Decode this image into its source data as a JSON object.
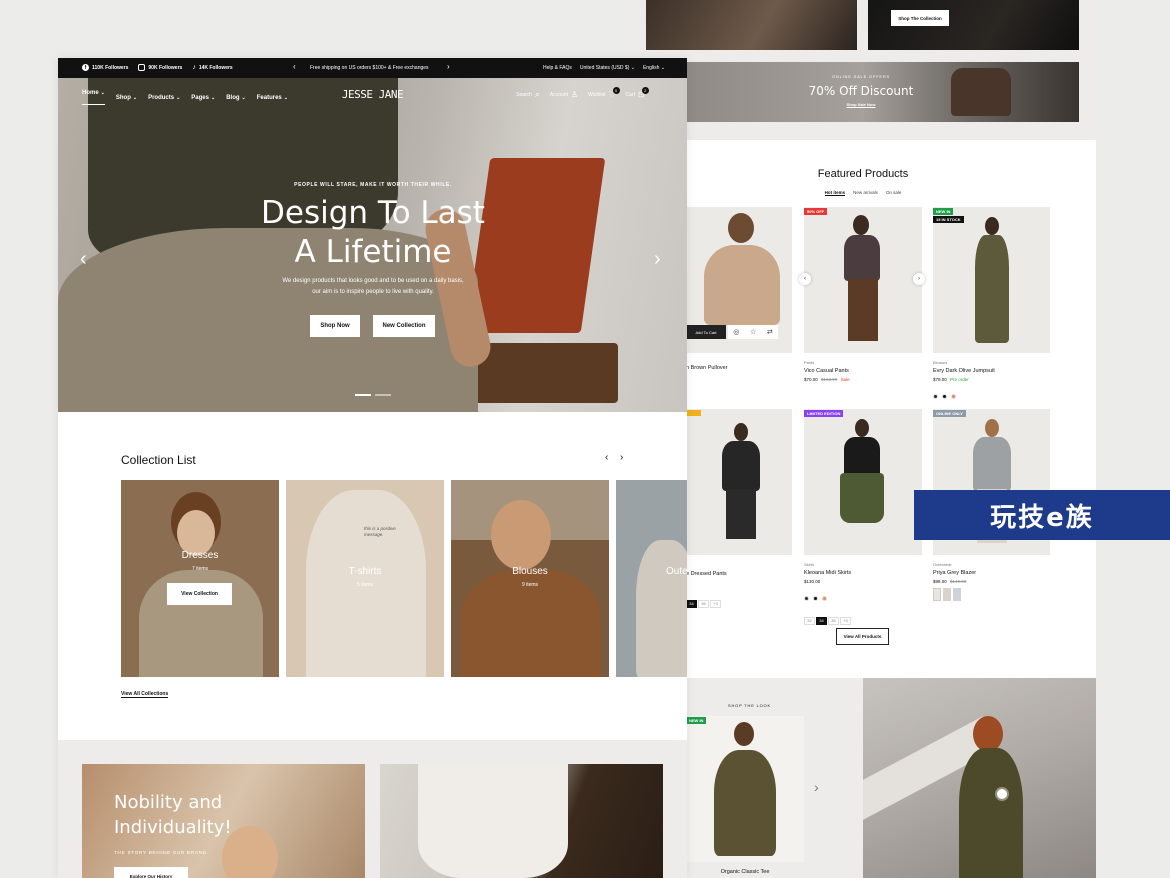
{
  "announcement": {
    "social": [
      {
        "icon": "facebook-icon",
        "label": "110K Followers"
      },
      {
        "icon": "instagram-icon",
        "label": "90K Followers"
      },
      {
        "icon": "tiktok-icon",
        "label": "14K Followers"
      }
    ],
    "message": "Free shipping on US orders $100+ & Free exchanges",
    "help": "Help & FAQs",
    "country": "United States (USD $)",
    "language": "English"
  },
  "header": {
    "logo": "JESSE JANE",
    "nav": [
      "Home",
      "Shop",
      "Products",
      "Pages",
      "Blog",
      "Features"
    ],
    "search": "Search",
    "account": "Account",
    "wishlist": "Wishlist",
    "wishlist_count": "0",
    "cart": "Cart",
    "cart_count": "2"
  },
  "hero": {
    "eyebrow": "PEOPLE WILL STARE, MAKE IT WORTH THEIR WHILE.",
    "title_line1": "Design To Last",
    "title_line2": "A Lifetime",
    "body": "We design products that looks good and to be used on a daily basis, our aim is to inspire people to live with quality.",
    "primary": "Shop Now",
    "secondary": "New Collection"
  },
  "collections": {
    "title": "Collection List",
    "items": [
      {
        "name": "Dresses",
        "count": "7 items",
        "cta": "View Collection"
      },
      {
        "name": "T-shirts",
        "count": "5 items",
        "tee_text": "this is a positive message."
      },
      {
        "name": "Blouses",
        "count": "9 items"
      },
      {
        "name": "Outer"
      }
    ],
    "view_all": "View All Collections"
  },
  "story": {
    "title_line1": "Nobility and",
    "title_line2": "Individuality!",
    "eyebrow": "THE STORY BEHIND OUR BRAND.",
    "cta": "Explore Our History"
  },
  "right_top": {
    "shop_collection": "Shop The Collection",
    "sale_eyebrow": "ONLINE SALE OFFERS",
    "sale_title": "70% Off Discount",
    "sale_cta": "Shop Sale Now"
  },
  "featured": {
    "title": "Featured Products",
    "tabs": [
      "Hot items",
      "New arrivals",
      "On sale"
    ],
    "products": [
      {
        "category": "",
        "name": "n Brown Pullover",
        "price": "",
        "badge": "",
        "quick": "Add To Cart"
      },
      {
        "category": "Pants",
        "name": "Vico Casual Pants",
        "price": "$70.00",
        "old_price": "$162.00",
        "sale_label": "Sale",
        "badge": "50% OFF"
      },
      {
        "category": "Blouses",
        "name": "Evry Dark Olive Jumpsuit",
        "price": "$79.00",
        "preorder": "Pre order",
        "badge": "NEW IN",
        "badge2": "15 IN STOCK"
      },
      {
        "category": "",
        "name": "e Dressed Pants",
        "sizes": [
          "34",
          "36",
          "+3"
        ]
      },
      {
        "category": "Skirts",
        "name": "Kleoana Midi Skirts",
        "price": "$130.00",
        "badge": "LIMITED EDITION",
        "sizes": [
          "32",
          "34",
          "36",
          "+3"
        ]
      },
      {
        "category": "Outerwear",
        "name": "Priya Grey Blazer",
        "price": "$98.00",
        "old_price": "$140.00",
        "badge": "ONLINE ONLY"
      }
    ],
    "view_all": "View All Products"
  },
  "shop_look": {
    "eyebrow": "SHOP THE LOOK",
    "badge": "NEW IN",
    "product": "Organic Classic Tee"
  },
  "watermark": "玩技e族",
  "colors": {
    "dark": "#111111",
    "sale": "#e53935",
    "preorder": "#2e9e4a",
    "limited": "#8a3ff0",
    "online": "#8d9aa8",
    "new_in": "#1f9e4a",
    "watermark_bg": "#1e3a8a"
  }
}
